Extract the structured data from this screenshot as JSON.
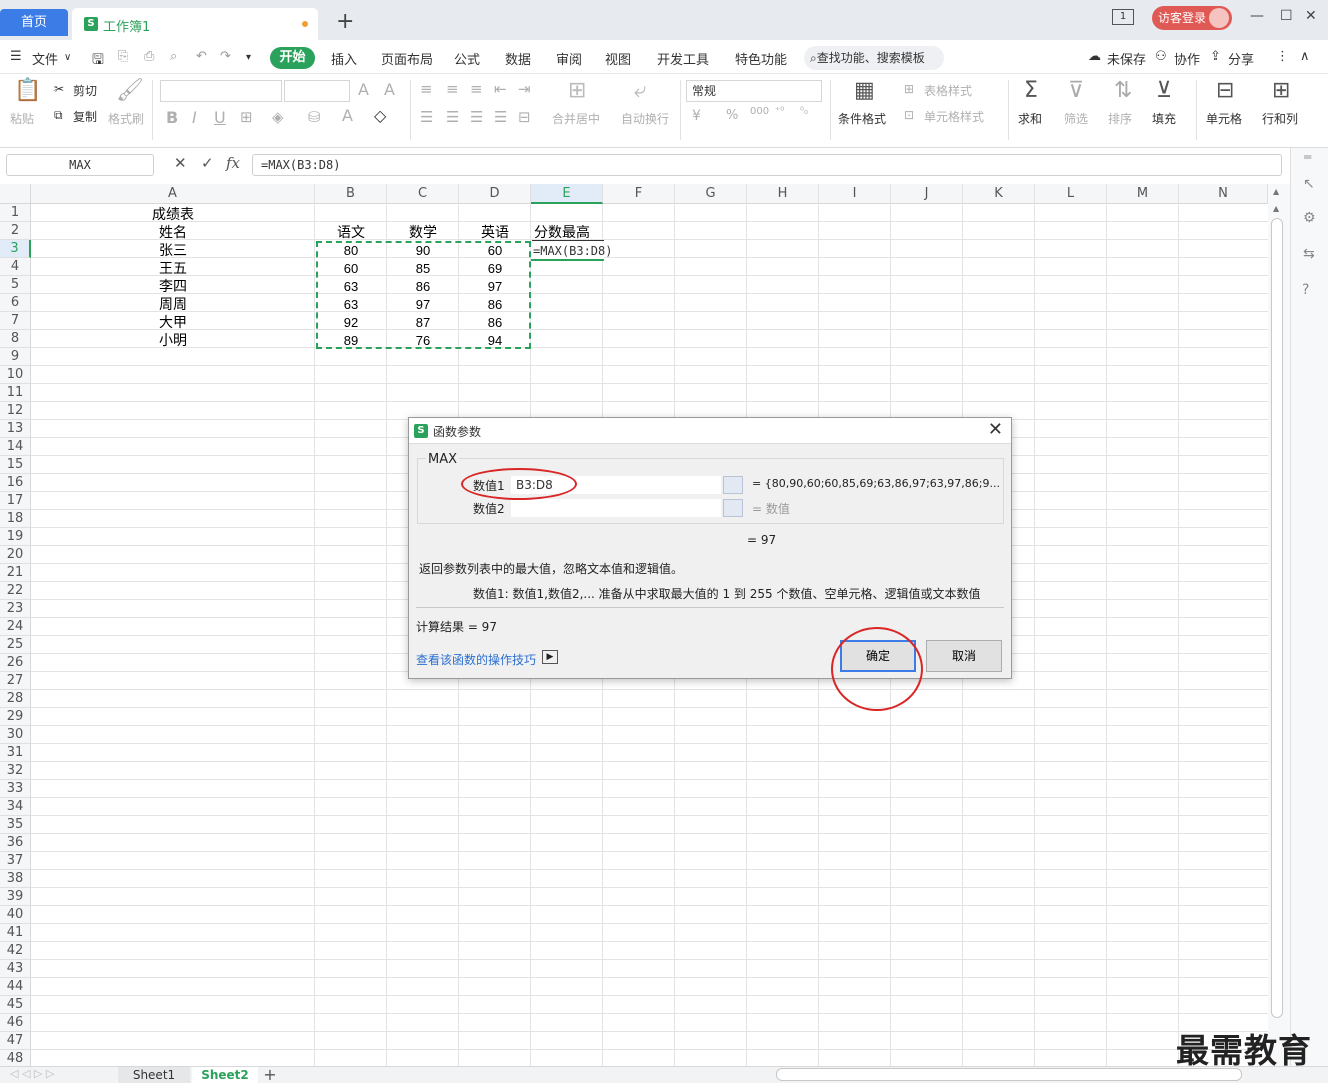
{
  "titlebar": {
    "home_tab": "首页",
    "doc_tab": "工作簿1",
    "new_tab": "+",
    "login": "访客登录",
    "min": "—",
    "max": "☐",
    "close": "✕"
  },
  "menu": {
    "hamburger": "☰",
    "file": "文件",
    "tabs": [
      "开始",
      "插入",
      "页面布局",
      "公式",
      "数据",
      "审阅",
      "视图",
      "开发工具",
      "特色功能"
    ],
    "search": "查找功能、搜索模板",
    "unsaved": "未保存",
    "collab": "协作",
    "share": "分享"
  },
  "ribbon": {
    "paste": "粘贴",
    "cut": "剪切",
    "copy": "复制",
    "format_painter": "格式刷",
    "merge": "合并居中",
    "wrap": "自动换行",
    "number_format": "常规",
    "percent": "%",
    "cond_format": "条件格式",
    "table_style": "表格样式",
    "cell_style": "单元格样式",
    "sum": "求和",
    "filter": "筛选",
    "sort": "排序",
    "fill": "填充",
    "cell": "单元格",
    "rowcol": "行和列"
  },
  "formula_bar": {
    "name_box": "MAX",
    "cancel": "✕",
    "confirm": "✓",
    "fx": "fx",
    "formula": "=MAX(B3:D8)"
  },
  "columns": [
    "A",
    "B",
    "C",
    "D",
    "E",
    "F",
    "G",
    "H",
    "I",
    "J",
    "K",
    "L",
    "M",
    "N"
  ],
  "rows": [
    "1",
    "2",
    "3",
    "4",
    "5",
    "6",
    "7",
    "8",
    "9",
    "10",
    "11",
    "12",
    "13",
    "14",
    "15",
    "16",
    "17",
    "18",
    "19",
    "20",
    "21",
    "22",
    "23",
    "24",
    "25",
    "26",
    "27",
    "28",
    "29",
    "30",
    "31",
    "32",
    "33",
    "34",
    "35",
    "36",
    "37",
    "38",
    "39",
    "40",
    "41",
    "42",
    "43",
    "44",
    "45",
    "46",
    "47",
    "48"
  ],
  "sheet": {
    "title": "成绩表",
    "headers": [
      "姓名",
      "语文",
      "数学",
      "英语",
      "分数最高"
    ],
    "students": [
      {
        "name": "张三",
        "yw": "80",
        "sx": "90",
        "yy": "60"
      },
      {
        "name": "王五",
        "yw": "60",
        "sx": "85",
        "yy": "69"
      },
      {
        "name": "李四",
        "yw": "63",
        "sx": "86",
        "yy": "97"
      },
      {
        "name": "周周",
        "yw": "63",
        "sx": "97",
        "yy": "86"
      },
      {
        "name": "大甲",
        "yw": "92",
        "sx": "87",
        "yy": "86"
      },
      {
        "name": "小明",
        "yw": "89",
        "sx": "76",
        "yy": "94"
      }
    ],
    "e3_formula": "=MAX(B3:D8)"
  },
  "dialog": {
    "title": "函数参数",
    "func_name": "MAX",
    "arg1_label": "数值1",
    "arg1_value": "B3:D8",
    "arg1_result": "= {80,90,60;60,85,69;63,86,97;63,97,86;9...",
    "arg2_label": "数值2",
    "arg2_value": "",
    "arg2_result": "= 数值",
    "result_line": "= 97",
    "description": "返回参数列表中的最大值，忽略文本值和逻辑值。",
    "arg_help": "数值1:  数值1,数值2,... 准备从中求取最大值的 1 到 255 个数值、空单元格、逻辑值或文本数值",
    "calc_result": "计算结果  =  97",
    "help_link": "查看该函数的操作技巧",
    "ok": "确定",
    "cancel": "取消"
  },
  "sheets": {
    "tabs": [
      "Sheet1",
      "Sheet2"
    ],
    "active": "Sheet2",
    "add": "+"
  },
  "watermark": "最需教育",
  "colors": {
    "accent_green": "#2ba25b",
    "accent_blue": "#3b7ce6",
    "annotation_red": "#d92626"
  }
}
